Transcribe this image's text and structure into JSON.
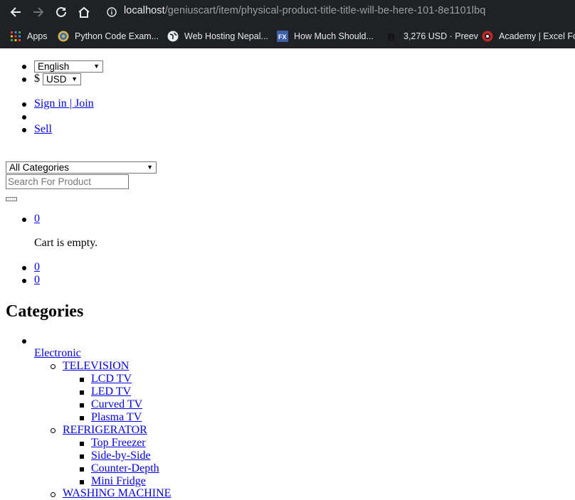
{
  "browser": {
    "url_host": "localhost",
    "url_path": "/geniuscart/item/physical-product-title-title-will-be-here-101-8e1101lbq",
    "bookmarks": [
      {
        "label": "Apps",
        "icon": "apps-grid-icon"
      },
      {
        "label": "Python Code Exam...",
        "icon": "python-icon"
      },
      {
        "label": "Web Hosting Nepal...",
        "icon": "globe-icon"
      },
      {
        "label": "How Much Should...",
        "icon": "fx-icon"
      },
      {
        "label": "3,276 USD · Preev",
        "icon": "bitcoin-icon"
      },
      {
        "label": "Academy | Excel For...",
        "icon": "academy-icon"
      }
    ]
  },
  "topbar": {
    "language": "English",
    "currency_symbol": "$",
    "currency": "USD",
    "sign_in": "Sign in",
    "separator": " | ",
    "join": "Join",
    "sell": "Sell"
  },
  "search": {
    "category": "All Categories",
    "placeholder": "Search For Product"
  },
  "cart": {
    "count": "0",
    "empty_text": "Cart is empty.",
    "wishlist_count": "0",
    "compare_count": "0"
  },
  "categories": {
    "heading": "Categories",
    "top": "Electronic",
    "sub1": "TELEVISION",
    "sub1_items": [
      "LCD TV",
      "LED TV",
      "Curved TV",
      "Plasma TV"
    ],
    "sub2": "REFRIGERATOR",
    "sub2_items": [
      "Top Freezer",
      "Side-by-Side",
      "Counter-Depth",
      "Mini Fridge"
    ],
    "sub3": "WASHING MACHINE"
  }
}
